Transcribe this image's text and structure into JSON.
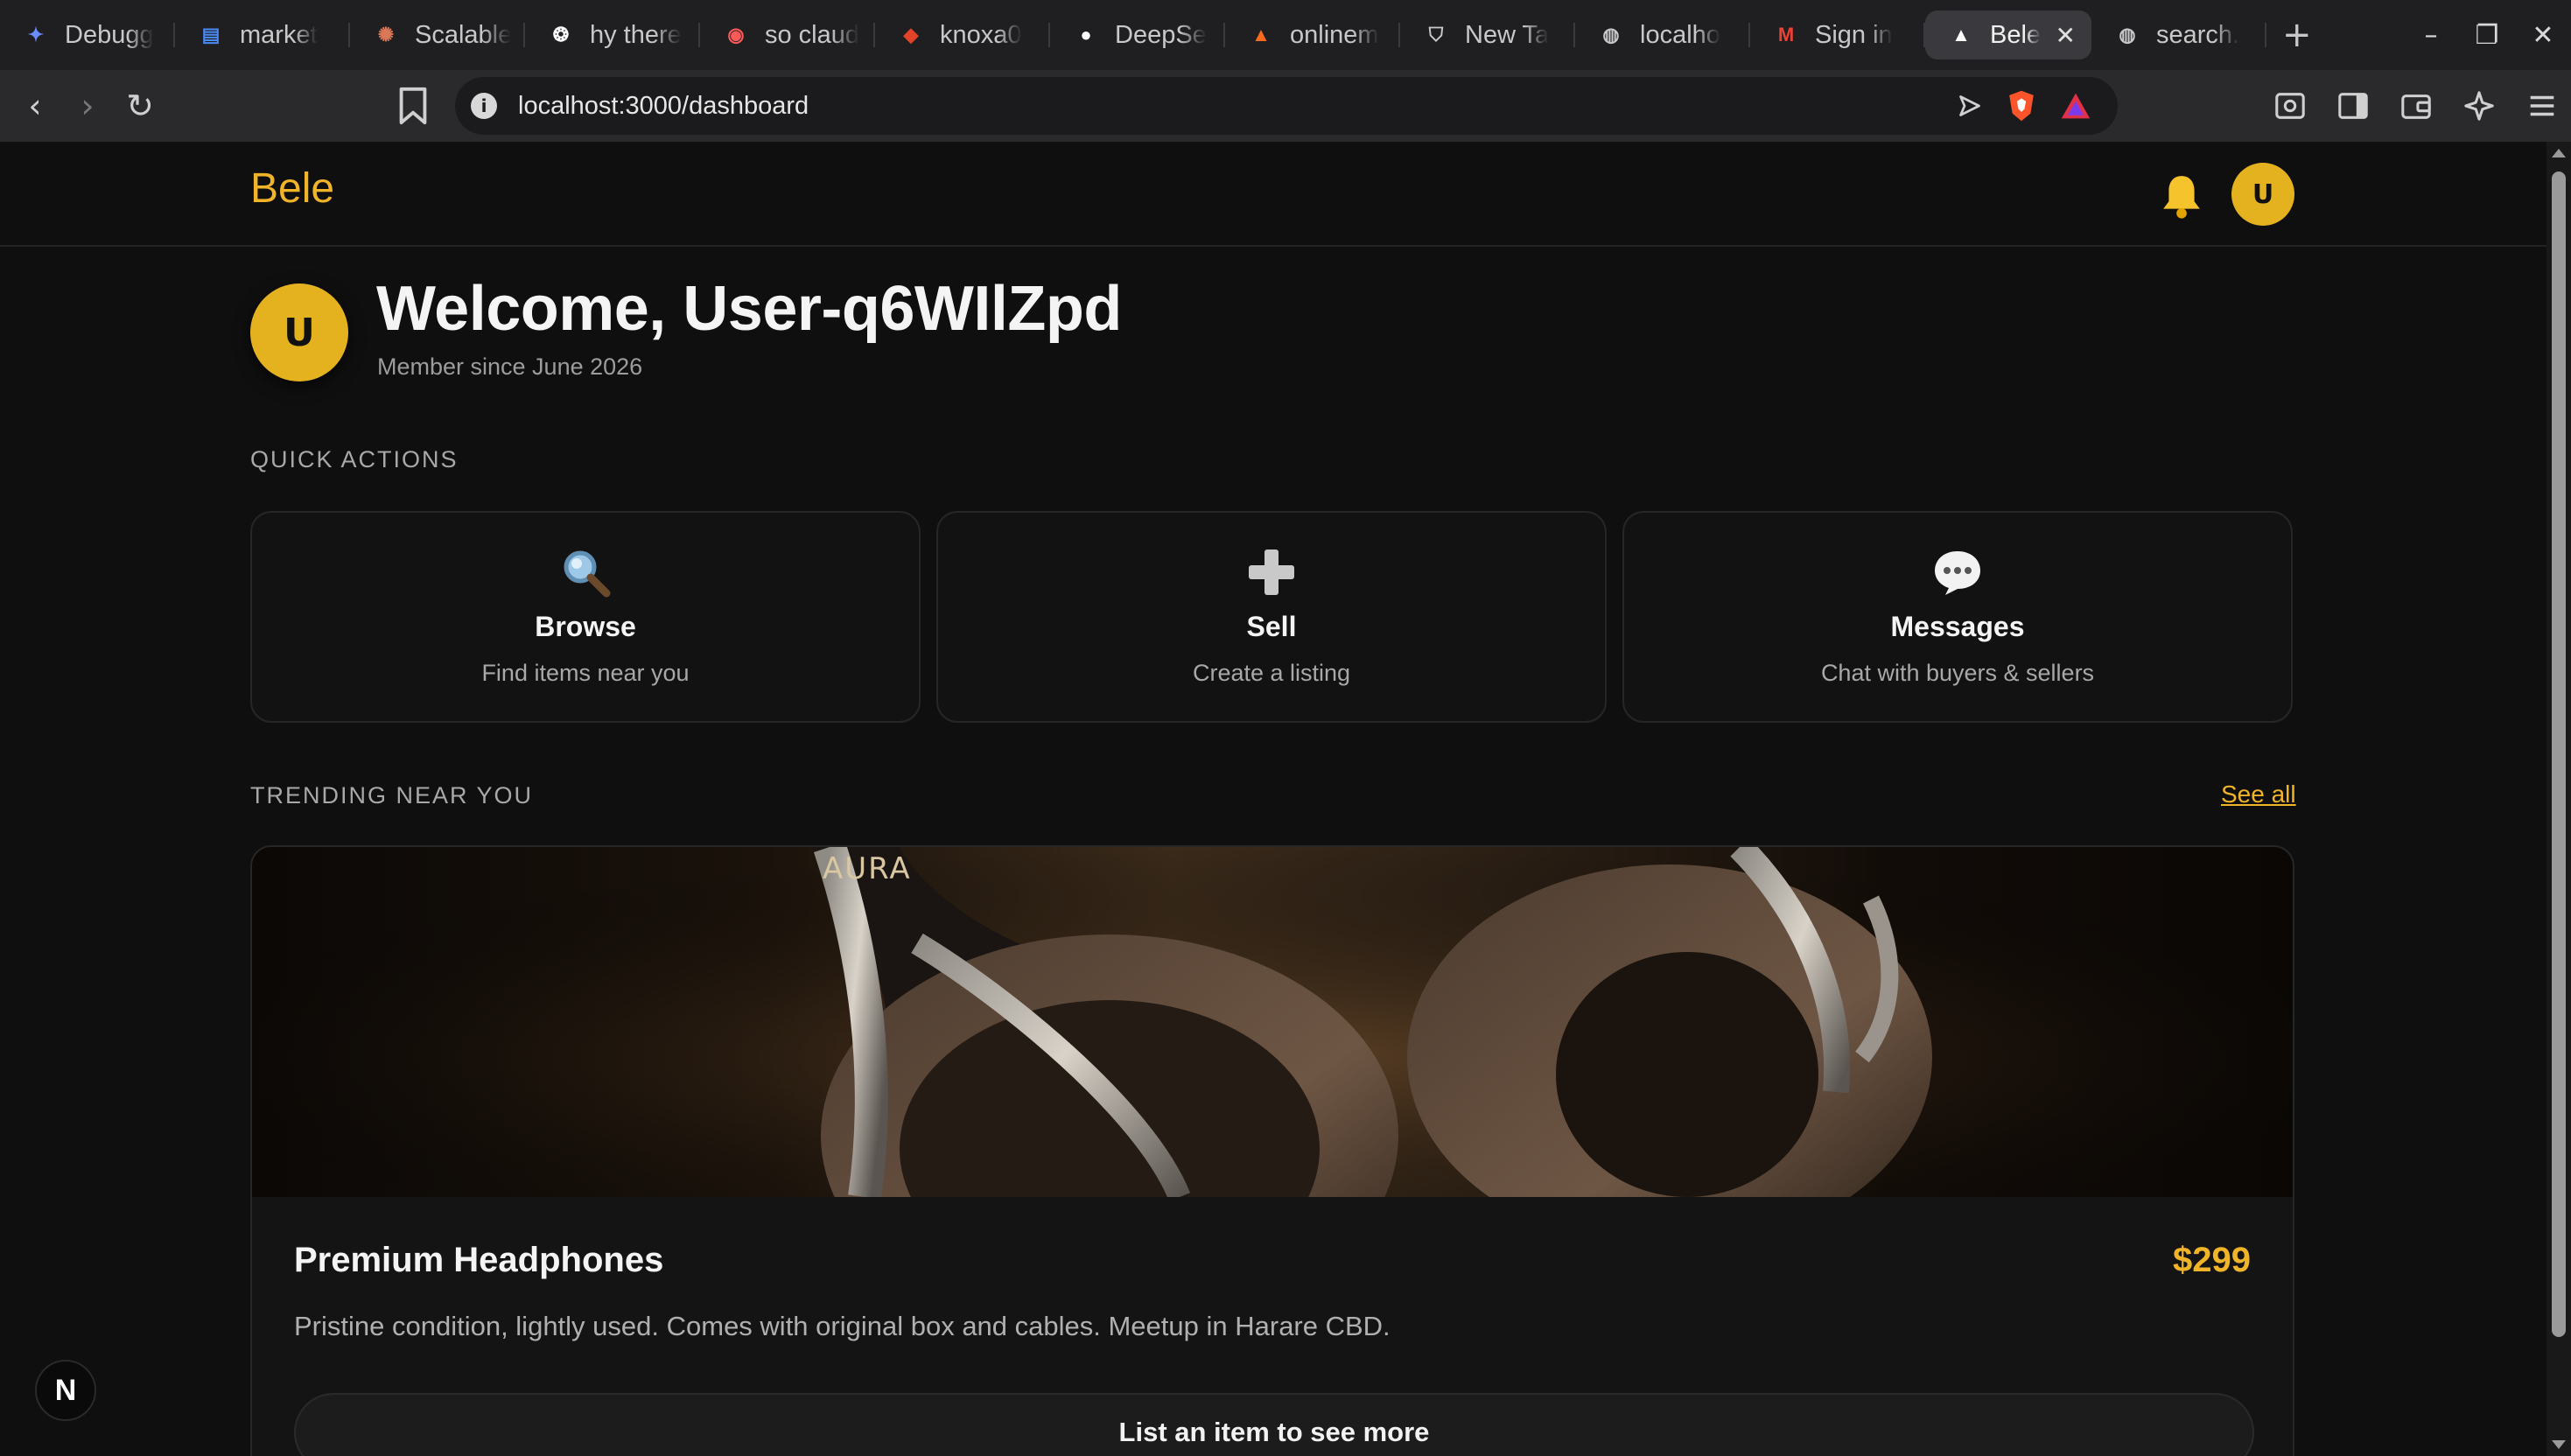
{
  "browser": {
    "tabs": [
      {
        "label": "Debugg",
        "icon": "gemini-sparkle-icon",
        "color": "#6b8cff"
      },
      {
        "label": "market",
        "icon": "docs-icon",
        "color": "#4a8af4"
      },
      {
        "label": "Scalable",
        "icon": "claude-burst-icon",
        "color": "#d97757"
      },
      {
        "label": "hy there",
        "icon": "openai-icon",
        "color": "#ffffff"
      },
      {
        "label": "so claud",
        "icon": "record-icon",
        "color": "#ff5a5a"
      },
      {
        "label": "knoxa0",
        "icon": "gitlab-icon",
        "color": "#e24329"
      },
      {
        "label": "DeepSe",
        "icon": "github-icon",
        "color": "#ffffff"
      },
      {
        "label": "onlinem",
        "icon": "fire-icon",
        "color": "#ff6a1a"
      },
      {
        "label": "New Ta",
        "icon": "shield-icon",
        "color": "#c8c8c8"
      },
      {
        "label": "localho",
        "icon": "globe-icon",
        "color": "#c8c8c8"
      },
      {
        "label": "Sign in",
        "icon": "gmail-icon",
        "color": "#ea4335"
      },
      {
        "label": "Bele",
        "icon": "triangle-icon",
        "color": "#ffffff",
        "active": true
      },
      {
        "label": "search.",
        "icon": "globe-icon",
        "color": "#c8c8c8"
      }
    ],
    "url": "localhost:3000/dashboard",
    "window_controls": [
      "–",
      "❐",
      "✕"
    ]
  },
  "header": {
    "brand": "Bele",
    "avatar_initial": "U"
  },
  "welcome": {
    "avatar_initial": "U",
    "title": "Welcome, User-q6WIlZpd",
    "member_since": "Member since June 2026"
  },
  "quick_actions": {
    "label": "QUICK ACTIONS",
    "items": [
      {
        "title": "Browse",
        "subtitle": "Find items near you",
        "icon": "magnifier-icon"
      },
      {
        "title": "Sell",
        "subtitle": "Create a listing",
        "icon": "plus-icon"
      },
      {
        "title": "Messages",
        "subtitle": "Chat with buyers & sellers",
        "icon": "speech-bubble-icon"
      }
    ]
  },
  "trending": {
    "label": "TRENDING NEAR YOU",
    "see_all": "See all",
    "listing": {
      "image_text": "AURA",
      "title": "Premium Headphones",
      "price": "$299",
      "description": "Pristine condition, lightly used. Comes with original box and cables. Meetup in Harare CBD.",
      "cta": "List an item to see more"
    }
  },
  "dev_badge": "N",
  "colors": {
    "accent": "#f0b429",
    "avatar": "#e5b21f",
    "background": "#0f0f10"
  }
}
